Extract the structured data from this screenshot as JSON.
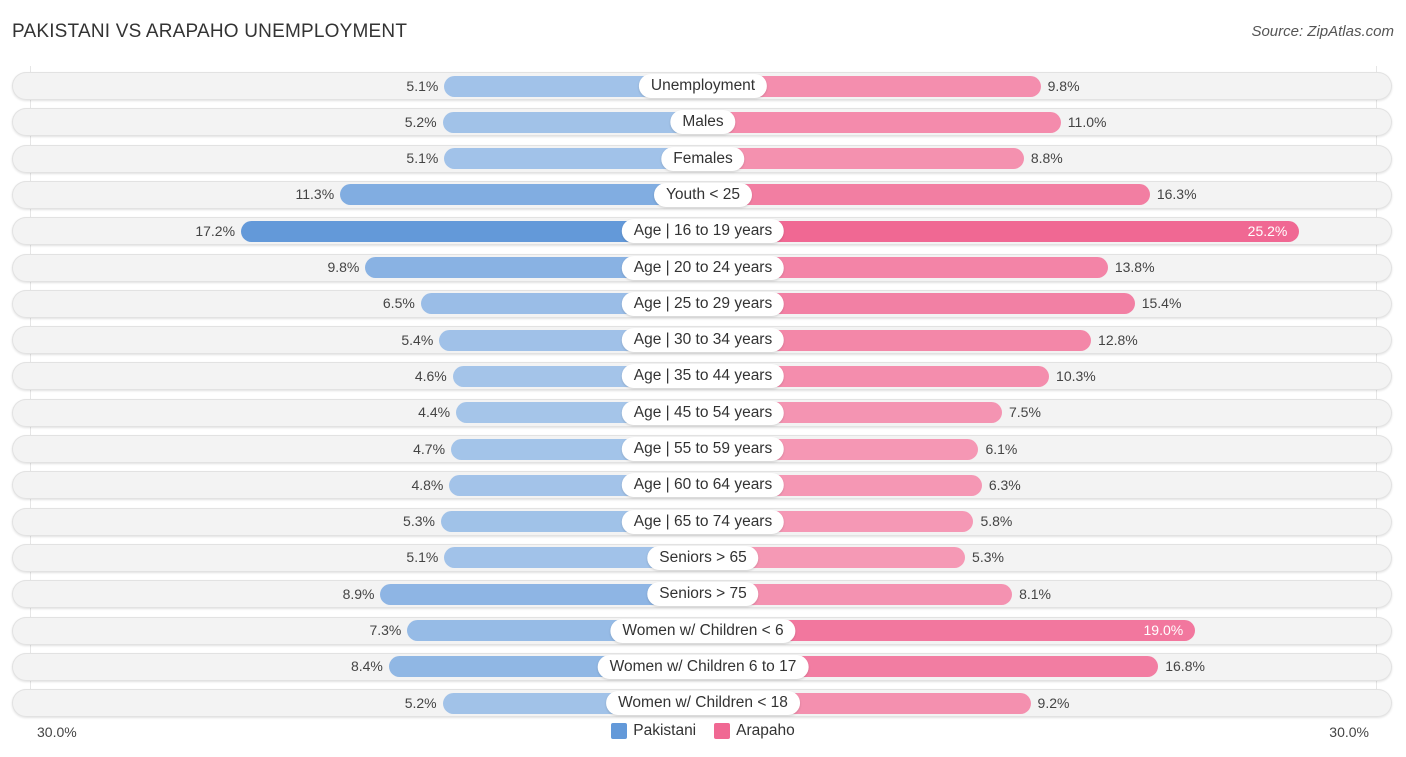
{
  "header": {
    "title": "PAKISTANI VS ARAPAHO UNEMPLOYMENT",
    "source": "Source: ZipAtlas.com"
  },
  "colors": {
    "pakistani_light": "#a7c6ea",
    "pakistani_strong": "#6399d9",
    "arapaho_light": "#f59ab6",
    "arapaho_strong": "#f06893",
    "row_bg": "#f3f3f3"
  },
  "chart_data": {
    "type": "bar",
    "orientation": "horizontal-diverging",
    "title": "PAKISTANI VS ARAPAHO UNEMPLOYMENT",
    "categories": [
      "Unemployment",
      "Males",
      "Females",
      "Youth < 25",
      "Age | 16 to 19 years",
      "Age | 20 to 24 years",
      "Age | 25 to 29 years",
      "Age | 30 to 34 years",
      "Age | 35 to 44 years",
      "Age | 45 to 54 years",
      "Age | 55 to 59 years",
      "Age | 60 to 64 years",
      "Age | 65 to 74 years",
      "Seniors > 65",
      "Seniors > 75",
      "Women w/ Children < 6",
      "Women w/ Children 6 to 17",
      "Women w/ Children < 18"
    ],
    "series": [
      {
        "name": "Pakistani",
        "side": "left",
        "values": [
          5.1,
          5.2,
          5.1,
          11.3,
          17.2,
          9.8,
          6.5,
          5.4,
          4.6,
          4.4,
          4.7,
          4.8,
          5.3,
          5.1,
          8.9,
          7.3,
          8.4,
          5.2
        ],
        "labels": [
          "5.1%",
          "5.2%",
          "5.1%",
          "11.3%",
          "17.2%",
          "9.8%",
          "6.5%",
          "5.4%",
          "4.6%",
          "4.4%",
          "4.7%",
          "4.8%",
          "5.3%",
          "5.1%",
          "8.9%",
          "7.3%",
          "8.4%",
          "5.2%"
        ]
      },
      {
        "name": "Arapaho",
        "side": "right",
        "values": [
          9.8,
          11.0,
          8.8,
          16.3,
          25.2,
          13.8,
          15.4,
          12.8,
          10.3,
          7.5,
          6.1,
          6.3,
          5.8,
          5.3,
          8.1,
          19.0,
          16.8,
          9.2
        ],
        "labels": [
          "9.8%",
          "11.0%",
          "8.8%",
          "16.3%",
          "25.2%",
          "13.8%",
          "15.4%",
          "12.8%",
          "10.3%",
          "7.5%",
          "6.1%",
          "6.3%",
          "5.8%",
          "5.3%",
          "8.1%",
          "19.0%",
          "16.8%",
          "9.2%"
        ]
      }
    ],
    "xlim": [
      -30,
      30
    ],
    "axis_labels": {
      "left": "30.0%",
      "right": "30.0%"
    },
    "legend": {
      "position": "bottom-center",
      "entries": [
        "Pakistani",
        "Arapaho"
      ]
    },
    "grid": false
  }
}
